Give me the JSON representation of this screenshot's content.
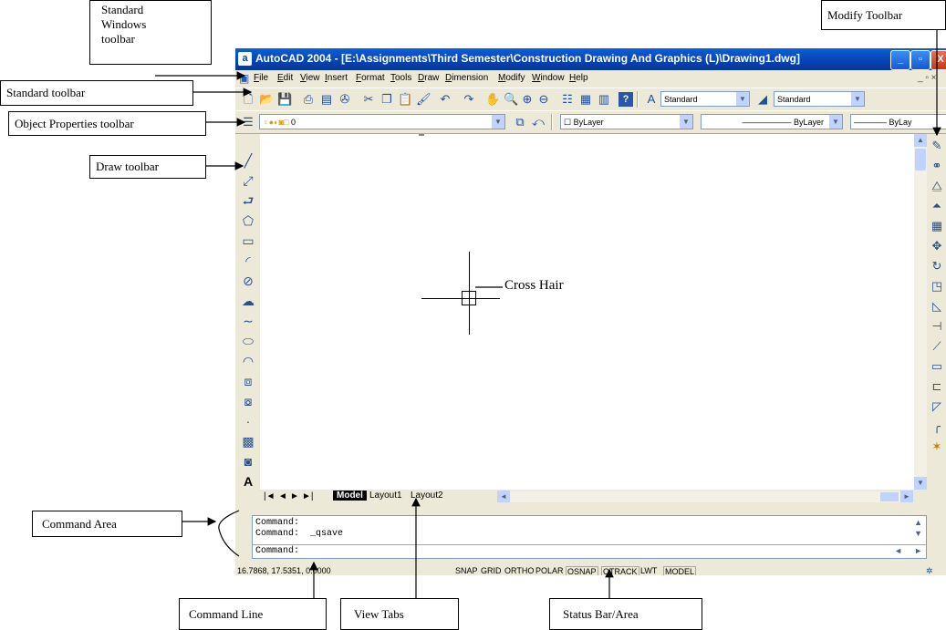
{
  "window": {
    "app_icon": "a",
    "title": "AutoCAD 2004 - [E:\\Assignments\\Third Semester\\Construction Drawing And Graphics (L)\\Drawing1.dwg]",
    "minimize": "_",
    "restore": "▫",
    "close": "X"
  },
  "menu": {
    "items": [
      "File",
      "Edit",
      "View",
      "Insert",
      "Format",
      "Tools",
      "Draw",
      "Dimension",
      "Modify",
      "Window",
      "Help"
    ],
    "doc_controls": "_ ▫ ×"
  },
  "standard_toolbar": {
    "icons": [
      "new-icon",
      "open-icon",
      "save-icon",
      "print-icon",
      "plot-preview-icon",
      "publish-icon",
      "cut-icon",
      "copy-icon",
      "paste-icon",
      "match-properties-icon",
      "undo-icon",
      "redo-icon",
      "pan-icon",
      "zoom-realtime-icon",
      "zoom-window-icon",
      "zoom-previous-icon",
      "properties-icon",
      "design-center-icon",
      "tool-palettes-icon",
      "help-icon"
    ],
    "text_style": "Standard",
    "dim_style": "Standard"
  },
  "properties_toolbar": {
    "layer": "0",
    "color": "ByLayer",
    "linetype": "ByLayer",
    "lineweight": "ByLay"
  },
  "draw_toolbar": {
    "icons": [
      "line-icon",
      "construction-line-icon",
      "polyline-icon",
      "polygon-icon",
      "rectangle-icon",
      "arc-icon",
      "circle-icon",
      "revision-cloud-icon",
      "spline-icon",
      "ellipse-icon",
      "ellipse-arc-icon",
      "insert-block-icon",
      "make-block-icon",
      "point-icon",
      "hatch-icon",
      "region-icon",
      "text-icon"
    ],
    "text_icon_label": "A"
  },
  "modify_toolbar": {
    "icons": [
      "erase-icon",
      "copy-object-icon",
      "mirror-icon",
      "offset-icon",
      "array-icon",
      "move-icon",
      "rotate-icon",
      "scale-icon",
      "stretch-icon",
      "trim-icon",
      "extend-icon",
      "break-at-point-icon",
      "break-icon",
      "chamfer-icon",
      "fillet-icon",
      "explode-icon"
    ]
  },
  "view_tabs": {
    "nav": [
      "|◄",
      "◄",
      "►",
      "►|"
    ],
    "tabs": [
      "Model",
      "Layout1",
      "Layout2"
    ]
  },
  "command_area": {
    "lines": [
      "Command:",
      "Command:  _qsave"
    ],
    "prompt": "Command:"
  },
  "status_bar": {
    "coords": "16.7868, 17.5351, 0.0000",
    "buttons": [
      "SNAP",
      "GRID",
      "ORTHO",
      "POLAR",
      "OSNAP",
      "OTRACK",
      "LWT",
      "MODEL"
    ]
  },
  "annotations": {
    "standard_windows_toolbar": "Standard\nWindows\ntoolbar",
    "standard_toolbar": "Standard toolbar",
    "object_properties_toolbar": "Object Properties toolbar",
    "draw_toolbar": "Draw toolbar",
    "modify_toolbar": "Modify Toolbar",
    "cross_hair": "Cross Hair",
    "command_area": "Command Area",
    "command_line": "Command Line",
    "view_tabs": "View Tabs",
    "status_bar": "Status Bar/Area"
  }
}
